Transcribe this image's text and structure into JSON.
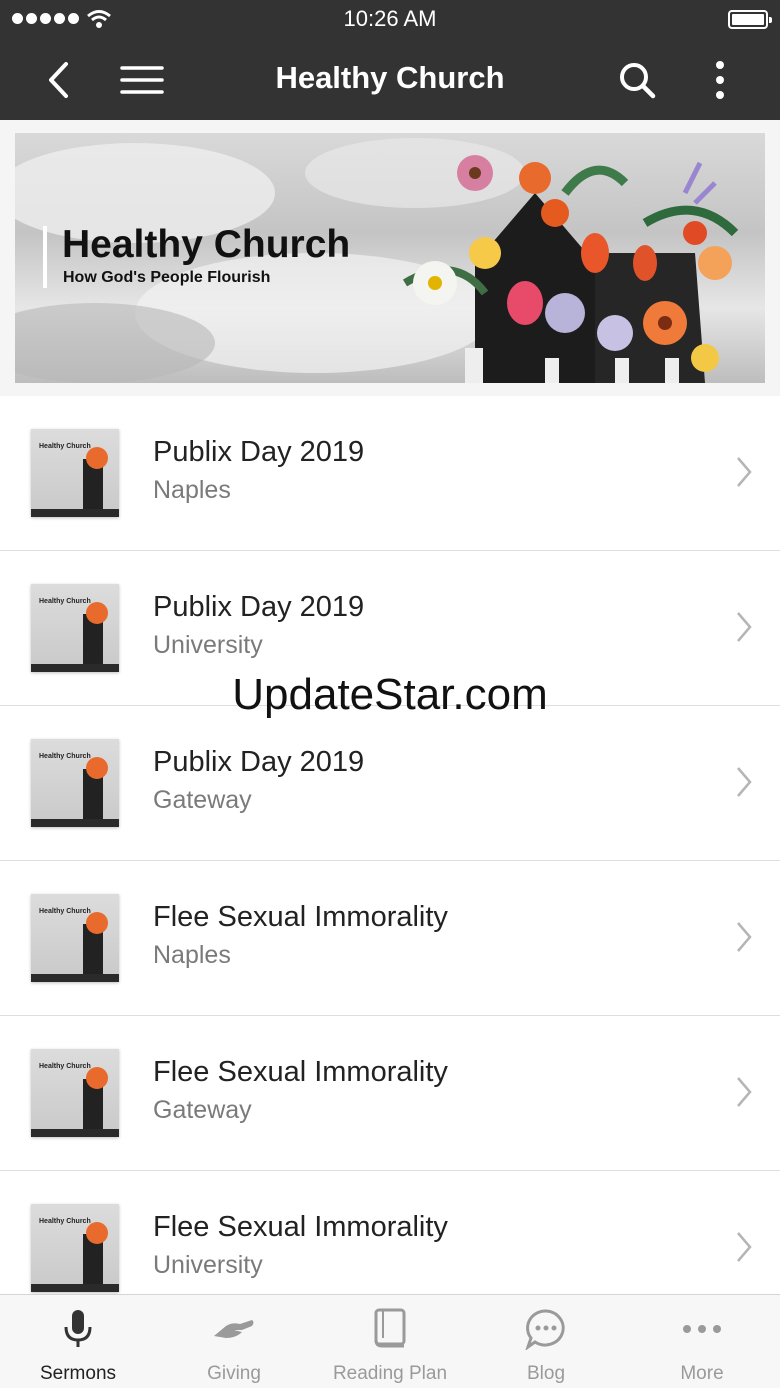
{
  "status_bar": {
    "time": "10:26 AM"
  },
  "nav": {
    "title": "Healthy Church"
  },
  "banner": {
    "title": "Healthy Church",
    "subtitle": "How God's People Flourish"
  },
  "thumb_text": "Healthy Church",
  "sermons": [
    {
      "title": "Publix Day 2019",
      "location": "Naples"
    },
    {
      "title": "Publix Day 2019",
      "location": "University"
    },
    {
      "title": "Publix Day 2019",
      "location": "Gateway"
    },
    {
      "title": "Flee Sexual Immorality",
      "location": "Naples"
    },
    {
      "title": "Flee Sexual Immorality",
      "location": "Gateway"
    },
    {
      "title": "Flee Sexual Immorality",
      "location": "University"
    }
  ],
  "watermark": "UpdateStar.com",
  "tabs": [
    {
      "label": "Sermons",
      "icon": "microphone-icon",
      "active": true
    },
    {
      "label": "Giving",
      "icon": "giving-hand-icon",
      "active": false
    },
    {
      "label": "Reading Plan",
      "icon": "book-icon",
      "active": false
    },
    {
      "label": "Blog",
      "icon": "chat-bubble-icon",
      "active": false
    },
    {
      "label": "More",
      "icon": "more-dots-icon",
      "active": false
    }
  ],
  "colors": {
    "header": "#333333",
    "accent_text": "#222222",
    "muted_text": "#7a7a7a"
  }
}
